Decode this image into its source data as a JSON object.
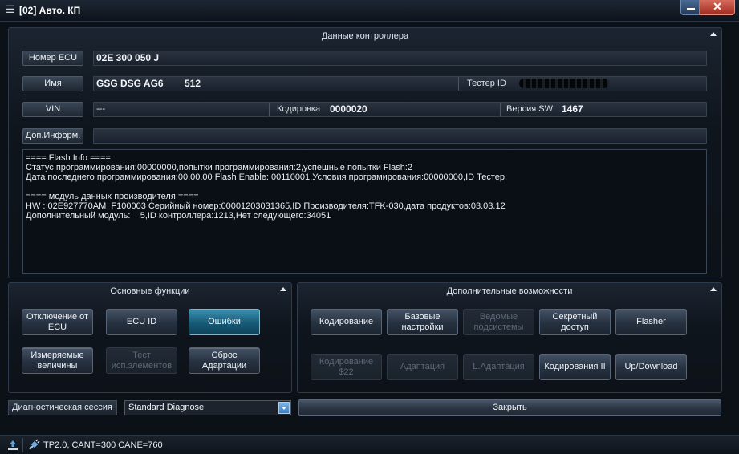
{
  "window": {
    "title": "[02] Авто. КП"
  },
  "controller": {
    "title": "Данные контроллера",
    "ecu_number_label": "Номер ECU",
    "ecu_number": "02E 300 050 J",
    "name_label": "Имя",
    "name_value": "GSG DSG AG6",
    "name_extra": "512",
    "tester_id_label": "Тестер ID",
    "vin_label": "VIN",
    "vin_value": "---",
    "coding_label": "Кодировка",
    "coding_value": "0000020",
    "sw_label": "Версия SW",
    "sw_value": "1467",
    "extra_info_label": "Доп.Информ.",
    "extra_info_value": ""
  },
  "log": {
    "lines": [
      "==== Flash Info ====",
      "Статус программирования:00000000,попытки программирования:2,успешные попытки Flash:2",
      "Дата последнего программирования:00.00.00 Flash Enable: 00110001,Условия програмирования:00000000,ID Тестер:",
      "",
      "==== модуль данных производителя ====",
      "HW : 02E927770AM  F100003 Серийный номер:00001203031365,ID Производителя:TFK-030,дата продуктов:03.03.12",
      "Дополнительный модуль:    5,ID контроллера:1213,Нет следующего:34051"
    ]
  },
  "basic": {
    "title": "Основные функции",
    "buttons": [
      "Отключение от\nECU",
      "ECU ID",
      "Ошибки",
      "Измеряемые\nвеличины",
      "Тест\nисп.элементов",
      "Сброс\nАдартации"
    ]
  },
  "advanced": {
    "title": "Дополнительные возможности",
    "buttons": [
      "Кодирование",
      "Базовые\nнастройки",
      "Ведомые\nподсистемы",
      "Секретный\nдоступ",
      "Flasher",
      "Кодирование\n$22",
      "Адаптация",
      "L.Адаптация",
      "Кодирования II",
      "Up/Download"
    ]
  },
  "session": {
    "label": "Диагностическая сессия",
    "selected": "Standard Diagnose"
  },
  "close_label": "Закрыть",
  "status": {
    "text": "TP2.0, CANT=300 CANE=760"
  }
}
